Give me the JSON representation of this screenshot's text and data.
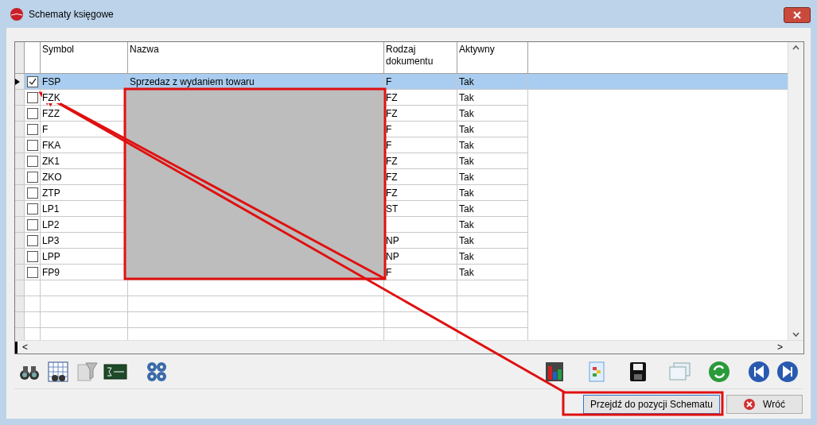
{
  "window": {
    "title": "Schematy księgowe"
  },
  "table": {
    "columns": [
      "Symbol",
      "Nazwa",
      "Rodzaj dokumentu",
      "Aktywny"
    ],
    "rows": [
      {
        "checked": true,
        "selected": true,
        "symbol": "FSP",
        "name": "Sprzedaz z wydaniem towaru",
        "type": "F",
        "active": "Tak"
      },
      {
        "checked": false,
        "selected": false,
        "symbol": "FZK",
        "type": "FZ",
        "active": "Tak"
      },
      {
        "checked": false,
        "selected": false,
        "symbol": "FZZ",
        "type": "FZ",
        "active": "Tak"
      },
      {
        "checked": false,
        "selected": false,
        "symbol": "F",
        "type": "F",
        "active": "Tak"
      },
      {
        "checked": false,
        "selected": false,
        "symbol": "FKA",
        "type": "F",
        "active": "Tak"
      },
      {
        "checked": false,
        "selected": false,
        "symbol": "ZK1",
        "type": "FZ",
        "active": "Tak"
      },
      {
        "checked": false,
        "selected": false,
        "symbol": "ZKO",
        "type": "FZ",
        "active": "Tak"
      },
      {
        "checked": false,
        "selected": false,
        "symbol": "ZTP",
        "type": "FZ",
        "active": "Tak"
      },
      {
        "checked": false,
        "selected": false,
        "symbol": "LP1",
        "type": "ST",
        "active": "Tak"
      },
      {
        "checked": false,
        "selected": false,
        "symbol": "LP2",
        "active": "Tak"
      },
      {
        "checked": false,
        "selected": false,
        "symbol": "LP3",
        "type": "NP",
        "active": "Tak"
      },
      {
        "checked": false,
        "selected": false,
        "symbol": "LPP",
        "type": "NP",
        "active": "Tak"
      },
      {
        "checked": false,
        "selected": false,
        "symbol": "FP9",
        "type": "F",
        "active": "Tak"
      }
    ]
  },
  "scroll_left": "<",
  "scroll_right": ">",
  "buttons": [
    {
      "label": "Przejdź do pozycji Schematu",
      "kind": "goto"
    },
    {
      "label": "Wróć",
      "kind": "back"
    }
  ]
}
